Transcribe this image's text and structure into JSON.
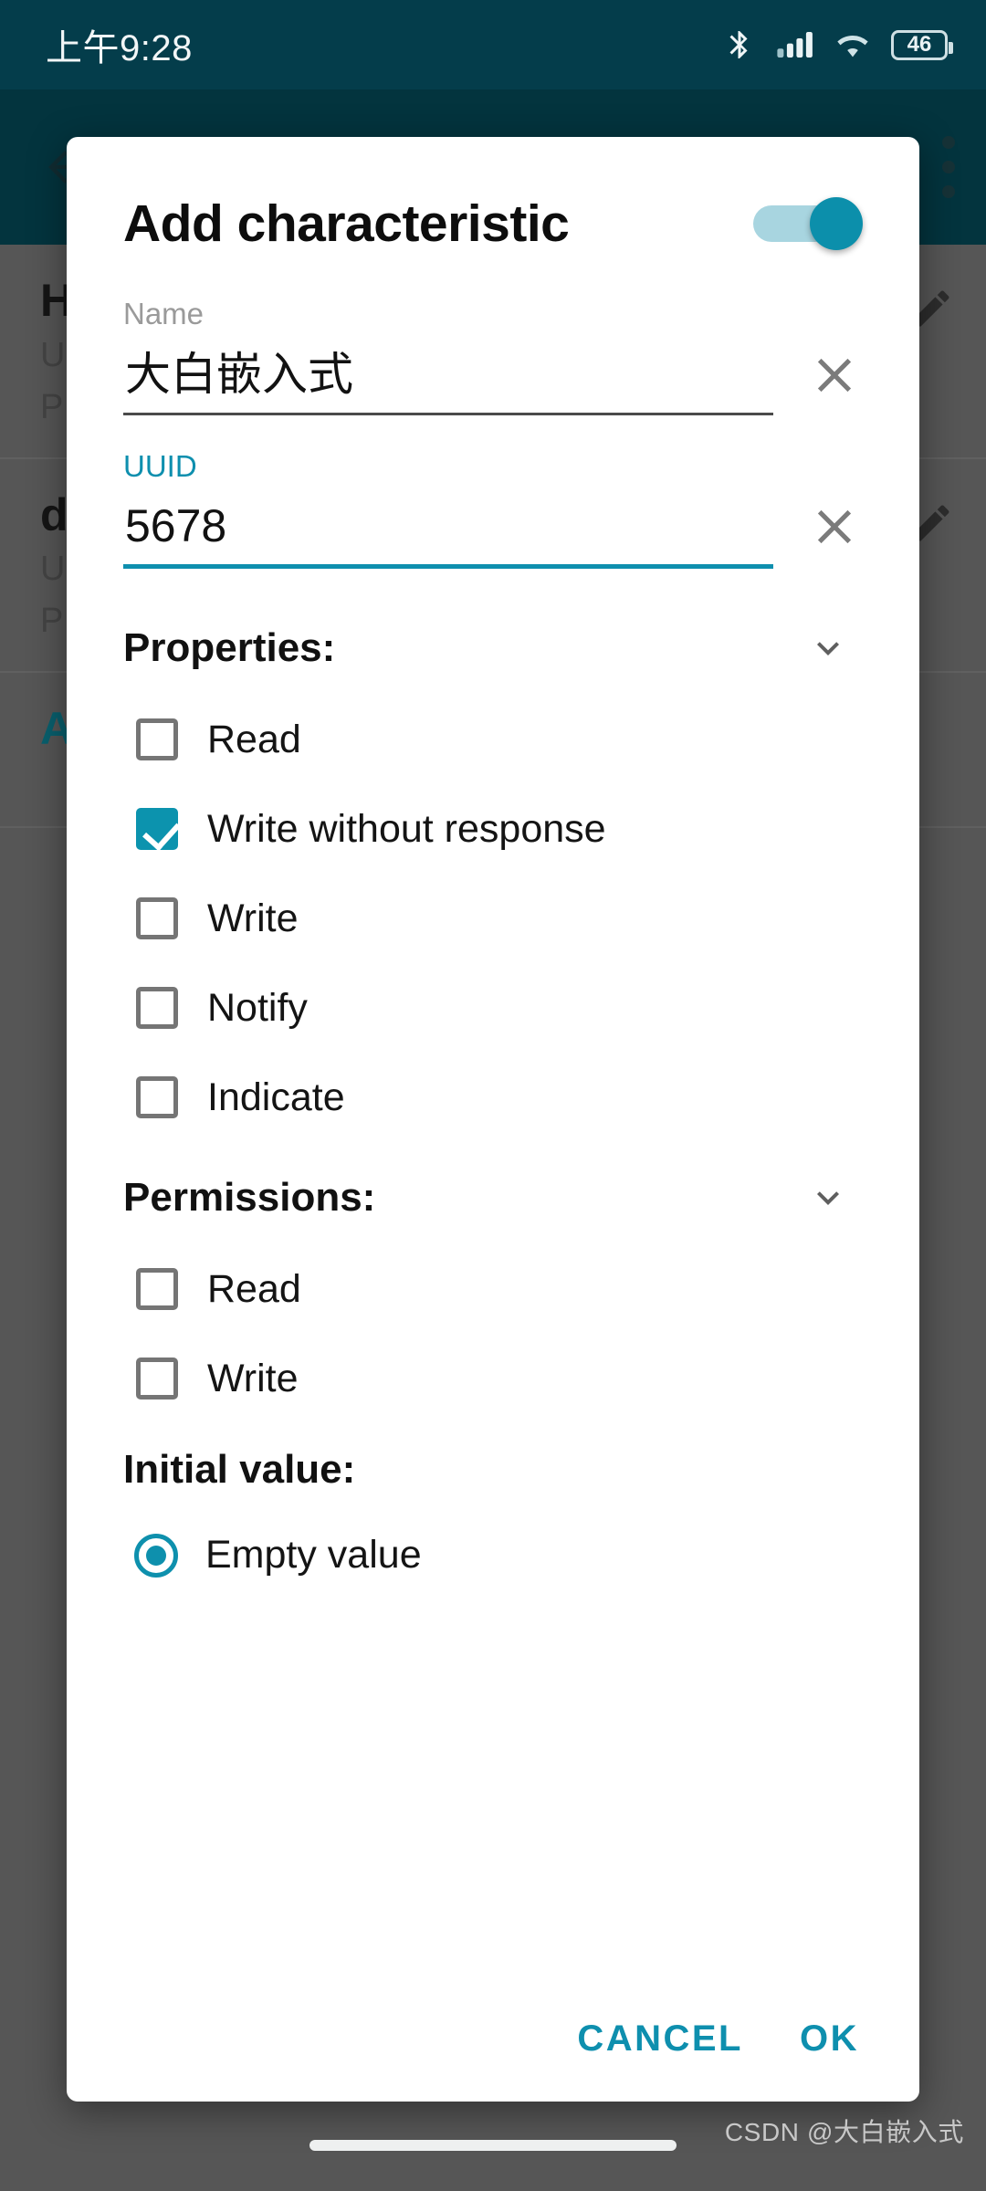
{
  "status_bar": {
    "clock": "上午9:28",
    "battery_level": "46",
    "icons": [
      "bluetooth-icon",
      "cellular-signal-icon",
      "wifi-icon",
      "battery-icon"
    ],
    "background_color": "#043d4b"
  },
  "app_bar": {
    "back_icon": "back-arrow-icon",
    "overflow_icon": "overflow-menu-icon",
    "background_color": "#044350"
  },
  "background_list": {
    "rows": [
      {
        "title": "H",
        "line1": "U",
        "line2": "P",
        "edit_icon": "pencil-icon"
      },
      {
        "title": "d",
        "line1": "U",
        "line2": "P",
        "edit_icon": "pencil-icon"
      },
      {
        "title": "A",
        "line1": "",
        "line2": "",
        "edit_icon": ""
      }
    ]
  },
  "dialog": {
    "title": "Add characteristic",
    "toggle": {
      "name": "advanced-toggle",
      "state": "on",
      "on_color": "#0c8fab",
      "track_color": "#a8d5e0"
    },
    "name_field": {
      "label": "Name",
      "value": "大白嵌入式",
      "placeholder": "Name",
      "focused": false,
      "clear_icon": "close-icon"
    },
    "uuid_field": {
      "label": "UUID",
      "value": "5678",
      "placeholder": "UUID",
      "focused": true,
      "clear_icon": "close-icon",
      "accent_color": "#0e8fae"
    },
    "properties": {
      "heading": "Properties:",
      "chevron_icon": "chevron-down-icon",
      "items": [
        {
          "label": "Read",
          "checked": false
        },
        {
          "label": "Write without response",
          "checked": true
        },
        {
          "label": "Write",
          "checked": false
        },
        {
          "label": "Notify",
          "checked": false
        },
        {
          "label": "Indicate",
          "checked": false
        }
      ]
    },
    "permissions": {
      "heading": "Permissions:",
      "chevron_icon": "chevron-down-icon",
      "items": [
        {
          "label": "Read",
          "checked": false
        },
        {
          "label": "Write",
          "checked": false
        }
      ]
    },
    "initial_value": {
      "heading": "Initial value:",
      "options": [
        {
          "label": "Empty value",
          "selected": true
        }
      ]
    },
    "actions": {
      "cancel_label": "CANCEL",
      "ok_label": "OK",
      "accent_color": "#0e8fae"
    }
  },
  "footer": {
    "watermark": "CSDN @大白嵌入式",
    "home_indicator": "home-gesture-bar"
  }
}
